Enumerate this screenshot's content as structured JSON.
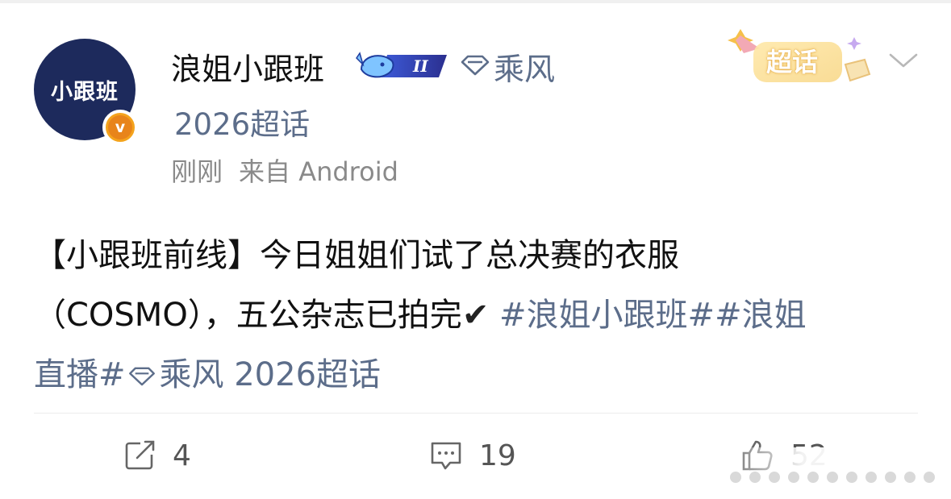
{
  "post": {
    "author": {
      "avatar_text": "小跟班",
      "verified_badge": "v",
      "name": "浪姐小跟班",
      "level_badge": "II",
      "topic_label": "乘风",
      "sub_topic": "2026超话"
    },
    "supertopic_badge": "超话",
    "meta": {
      "time": "刚刚",
      "source": "来自 Android"
    },
    "content": {
      "text_line1": "【小跟班前线】今日姐姐们试了总决赛的衣服",
      "text_line2": "（COSMO），五公杂志已拍完",
      "check": "✔",
      "hashtag1": "#浪姐小跟班#",
      "hashtag2_part1": "#浪姐",
      "hashtag2_part2": "直播#",
      "topic_link": "乘风 2026超话"
    },
    "actions": {
      "repost_count": "4",
      "comment_count": "19",
      "like_count": "52"
    }
  },
  "colors": {
    "link": "#5c6d8a",
    "avatar_bg": "#1d2a5c",
    "badge_gold": "#f4a31c"
  }
}
